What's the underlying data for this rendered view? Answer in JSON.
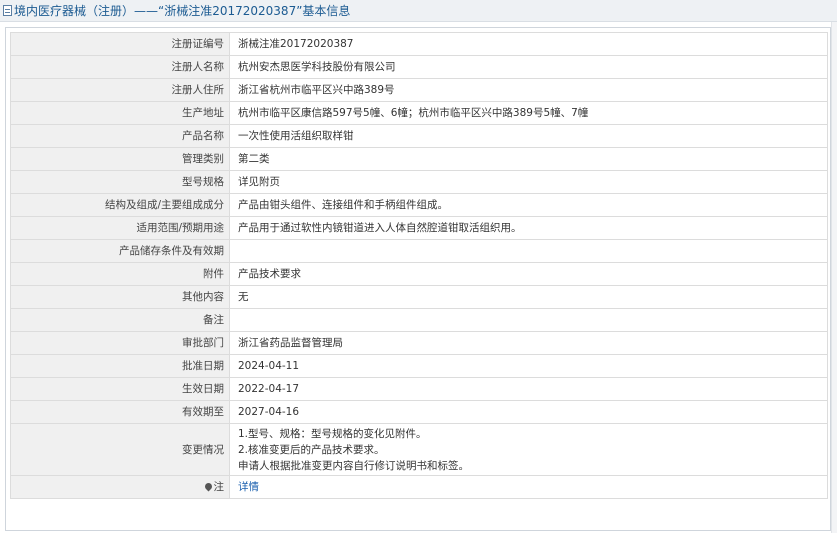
{
  "header": {
    "title": "境内医疗器械（注册）——“浙械注准20172020387”基本信息"
  },
  "rows": [
    {
      "label": "注册证编号",
      "value": "浙械注准20172020387"
    },
    {
      "label": "注册人名称",
      "value": "杭州安杰思医学科技股份有限公司"
    },
    {
      "label": "注册人住所",
      "value": "浙江省杭州市临平区兴中路389号"
    },
    {
      "label": "生产地址",
      "value": "杭州市临平区康信路597号5幢、6幢；杭州市临平区兴中路389号5幢、7幢"
    },
    {
      "label": "产品名称",
      "value": "一次性使用活组织取样钳"
    },
    {
      "label": "管理类别",
      "value": "第二类"
    },
    {
      "label": "型号规格",
      "value": "详见附页"
    },
    {
      "label": "结构及组成/主要组成成分",
      "value": "产品由钳头组件、连接组件和手柄组件组成。"
    },
    {
      "label": "适用范围/预期用途",
      "value": "产品用于通过软性内镜钳道进入人体自然腔道钳取活组织用。"
    },
    {
      "label": "产品储存条件及有效期",
      "value": ""
    },
    {
      "label": "附件",
      "value": "产品技术要求"
    },
    {
      "label": "其他内容",
      "value": "无"
    },
    {
      "label": "备注",
      "value": ""
    },
    {
      "label": "审批部门",
      "value": "浙江省药品监督管理局"
    },
    {
      "label": "批准日期",
      "value": "2024-04-11"
    },
    {
      "label": "生效日期",
      "value": "2022-04-17"
    },
    {
      "label": "有效期至",
      "value": "2027-04-16"
    }
  ],
  "change": {
    "label": "变更情况",
    "lines": [
      "1.型号、规格：型号规格的变化见附件。",
      "2.核准变更后的产品技术要求。",
      "申请人根据批准变更内容自行修订说明书和标签。"
    ]
  },
  "note": {
    "label": "注",
    "link": "详情"
  }
}
